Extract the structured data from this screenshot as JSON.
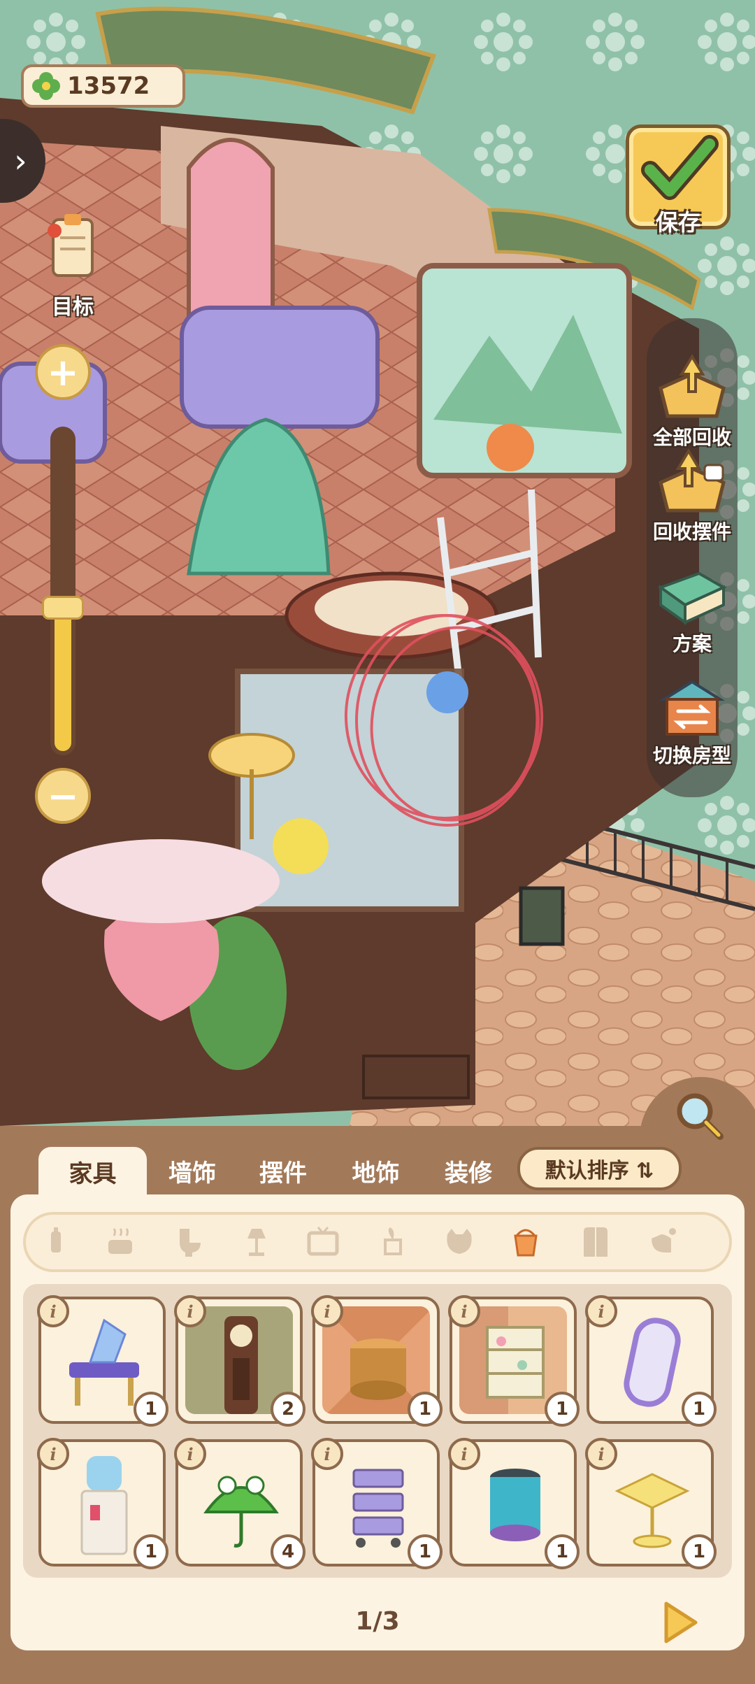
{
  "hud": {
    "coins": "13572",
    "goal_label": "目标",
    "save_label": "保存",
    "zoom_level": 0.45
  },
  "right_panel": {
    "items": [
      {
        "label": "全部回收",
        "icon": "recycle-all-icon"
      },
      {
        "label": "回收摆件",
        "icon": "recycle-decor-icon"
      },
      {
        "label": "方案",
        "icon": "blueprint-icon"
      },
      {
        "label": "切换房型",
        "icon": "switch-room-icon"
      }
    ]
  },
  "tabs": [
    {
      "label": "家具",
      "active": true
    },
    {
      "label": "墙饰",
      "active": false
    },
    {
      "label": "摆件",
      "active": false
    },
    {
      "label": "地饰",
      "active": false
    },
    {
      "label": "装修",
      "active": false
    }
  ],
  "sort_label": "默认排序 ⇅",
  "categories": [
    {
      "icon": "small-bottle-icon",
      "active": false
    },
    {
      "icon": "cooking-pot-icon",
      "active": false
    },
    {
      "icon": "toilet-icon",
      "active": false
    },
    {
      "icon": "lamp-icon",
      "active": false
    },
    {
      "icon": "tv-icon",
      "active": false
    },
    {
      "icon": "plant-stand-icon",
      "active": false
    },
    {
      "icon": "cat-icon",
      "active": false
    },
    {
      "icon": "bucket-icon",
      "active": true
    },
    {
      "icon": "wardrobe-icon",
      "active": false
    },
    {
      "icon": "watering-can-icon",
      "active": false
    }
  ],
  "items": [
    {
      "name": "crystal-vanity-desk",
      "count": "1"
    },
    {
      "name": "grandfather-clock",
      "count": "2"
    },
    {
      "name": "woven-basket-stool",
      "count": "1"
    },
    {
      "name": "dessert-cart-shelf",
      "count": "1"
    },
    {
      "name": "vanity-mirror",
      "count": "1"
    },
    {
      "name": "water-dispenser",
      "count": "1"
    },
    {
      "name": "frog-umbrella",
      "count": "4"
    },
    {
      "name": "purple-trolley-cart",
      "count": "1"
    },
    {
      "name": "trash-can",
      "count": "1"
    },
    {
      "name": "yellow-side-table",
      "count": "1"
    }
  ],
  "info_glyph": "i",
  "pager": "1/3",
  "colors": {
    "background": "#8fc1a8",
    "panel": "#a27a5a",
    "cream": "#fdf3e3",
    "gold": "#f4c947",
    "dark_brown": "#5a3a22"
  }
}
